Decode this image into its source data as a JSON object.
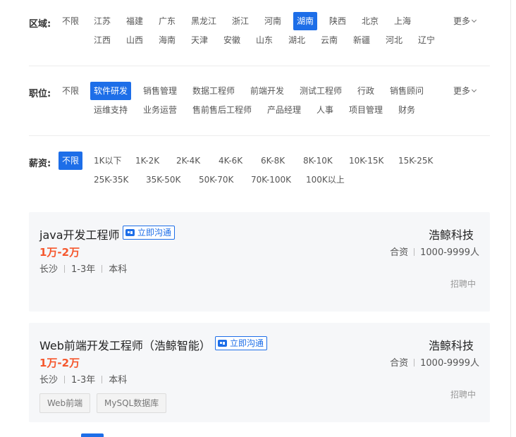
{
  "filters": {
    "region": {
      "title": "区域:",
      "none": "不限",
      "more": "更多",
      "row1": [
        "江苏",
        "福建",
        "广东",
        "黑龙江",
        "浙江",
        "河南",
        "湖南",
        "陕西",
        "北京",
        "上海"
      ],
      "row2": [
        "江西",
        "山西",
        "海南",
        "天津",
        "安徽",
        "山东",
        "湖北",
        "云南",
        "新疆",
        "河北",
        "辽宁"
      ],
      "selected": "湖南"
    },
    "position": {
      "title": "职位:",
      "none": "不限",
      "more": "更多",
      "row1": [
        "软件研发",
        "销售管理",
        "数据工程师",
        "前端开发",
        "测试工程师",
        "行政",
        "销售顾问"
      ],
      "row2": [
        "运维支持",
        "业务运营",
        "售前售后工程师",
        "产品经理",
        "人事",
        "项目管理",
        "财务"
      ],
      "selected": "软件研发"
    },
    "salary": {
      "title": "薪资:",
      "none": "不限",
      "row1": [
        "1K以下",
        "1K-2K",
        "2K-4K",
        "4K-6K",
        "6K-8K",
        "8K-10K",
        "10K-15K",
        "15K-25K"
      ],
      "row2": [
        "25K-35K",
        "35K-50K",
        "50K-70K",
        "70K-100K",
        "100K以上"
      ],
      "selected": "不限"
    }
  },
  "jobs": [
    {
      "title": "java开发工程师",
      "chat_label": "立即沟通",
      "salary": "1万-2万",
      "city": "长沙",
      "experience": "1-3年",
      "education": "本科",
      "company": "浩鲸科技",
      "company_type": "合资",
      "company_size": "1000-9999人",
      "status": "招聘中",
      "tags": []
    },
    {
      "title": "Web前端开发工程师（浩鲸智能）",
      "chat_label": "立即沟通",
      "salary": "1万-2万",
      "city": "长沙",
      "experience": "1-3年",
      "education": "本科",
      "company": "浩鲸科技",
      "company_type": "合资",
      "company_size": "1000-9999人",
      "status": "招聘中",
      "tags": [
        "Web前端",
        "MySQL数据库"
      ]
    }
  ],
  "colors": {
    "accent": "#1d6ee8",
    "salary": "#f5572d"
  }
}
